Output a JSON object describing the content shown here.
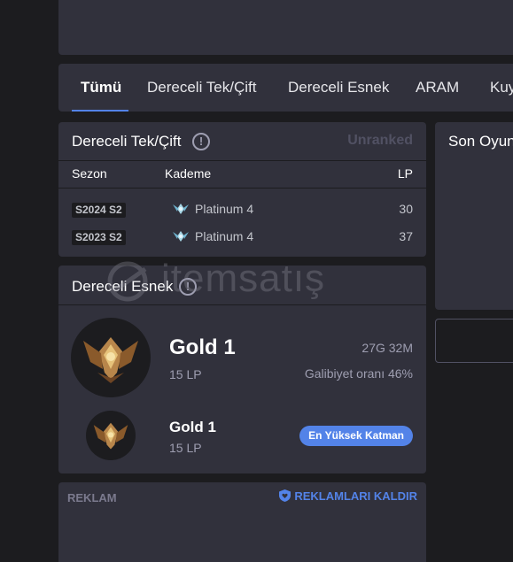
{
  "tabs": [
    {
      "label": "Tümü",
      "active": true
    },
    {
      "label": "Dereceli Tek/Çift",
      "active": false
    },
    {
      "label": "Dereceli Esnek",
      "active": false
    },
    {
      "label": "ARAM",
      "active": false
    },
    {
      "label": "Kuy",
      "active": false
    }
  ],
  "solo": {
    "title": "Dereceli Tek/Çift",
    "info_icon": "!",
    "status": "Unranked",
    "columns": {
      "season": "Sezon",
      "tier": "Kademe",
      "lp": "LP"
    },
    "rows": [
      {
        "season": "S2024 S2",
        "tier": "Platinum 4",
        "lp": "30"
      },
      {
        "season": "S2023 S2",
        "tier": "Platinum 4",
        "lp": "37"
      }
    ]
  },
  "flex": {
    "title": "Dereceli Esnek",
    "info_icon": "!",
    "current": {
      "tier": "Gold 1",
      "lp": "15 LP",
      "record": "27G 32M",
      "winrate": "Galibiyet oranı 46%"
    },
    "highest": {
      "tier": "Gold 1",
      "lp": "15 LP",
      "badge": "En Yüksek Katman"
    }
  },
  "ad": {
    "label": "REKLAM",
    "remove": "REKLAMLARI KALDIR"
  },
  "recent": {
    "title": "Son Oyun"
  },
  "watermark": {
    "text": "itemsatış"
  },
  "icons": {
    "info": "info-icon",
    "platinum": "platinum-emblem-icon",
    "gold": "gold-emblem-icon",
    "shield": "shield-heart-icon"
  },
  "colors": {
    "background": "#1c1c1f",
    "panel": "#31313c",
    "accent": "#5383e8",
    "muted": "#9e9eb1",
    "unranked": "#515163"
  }
}
